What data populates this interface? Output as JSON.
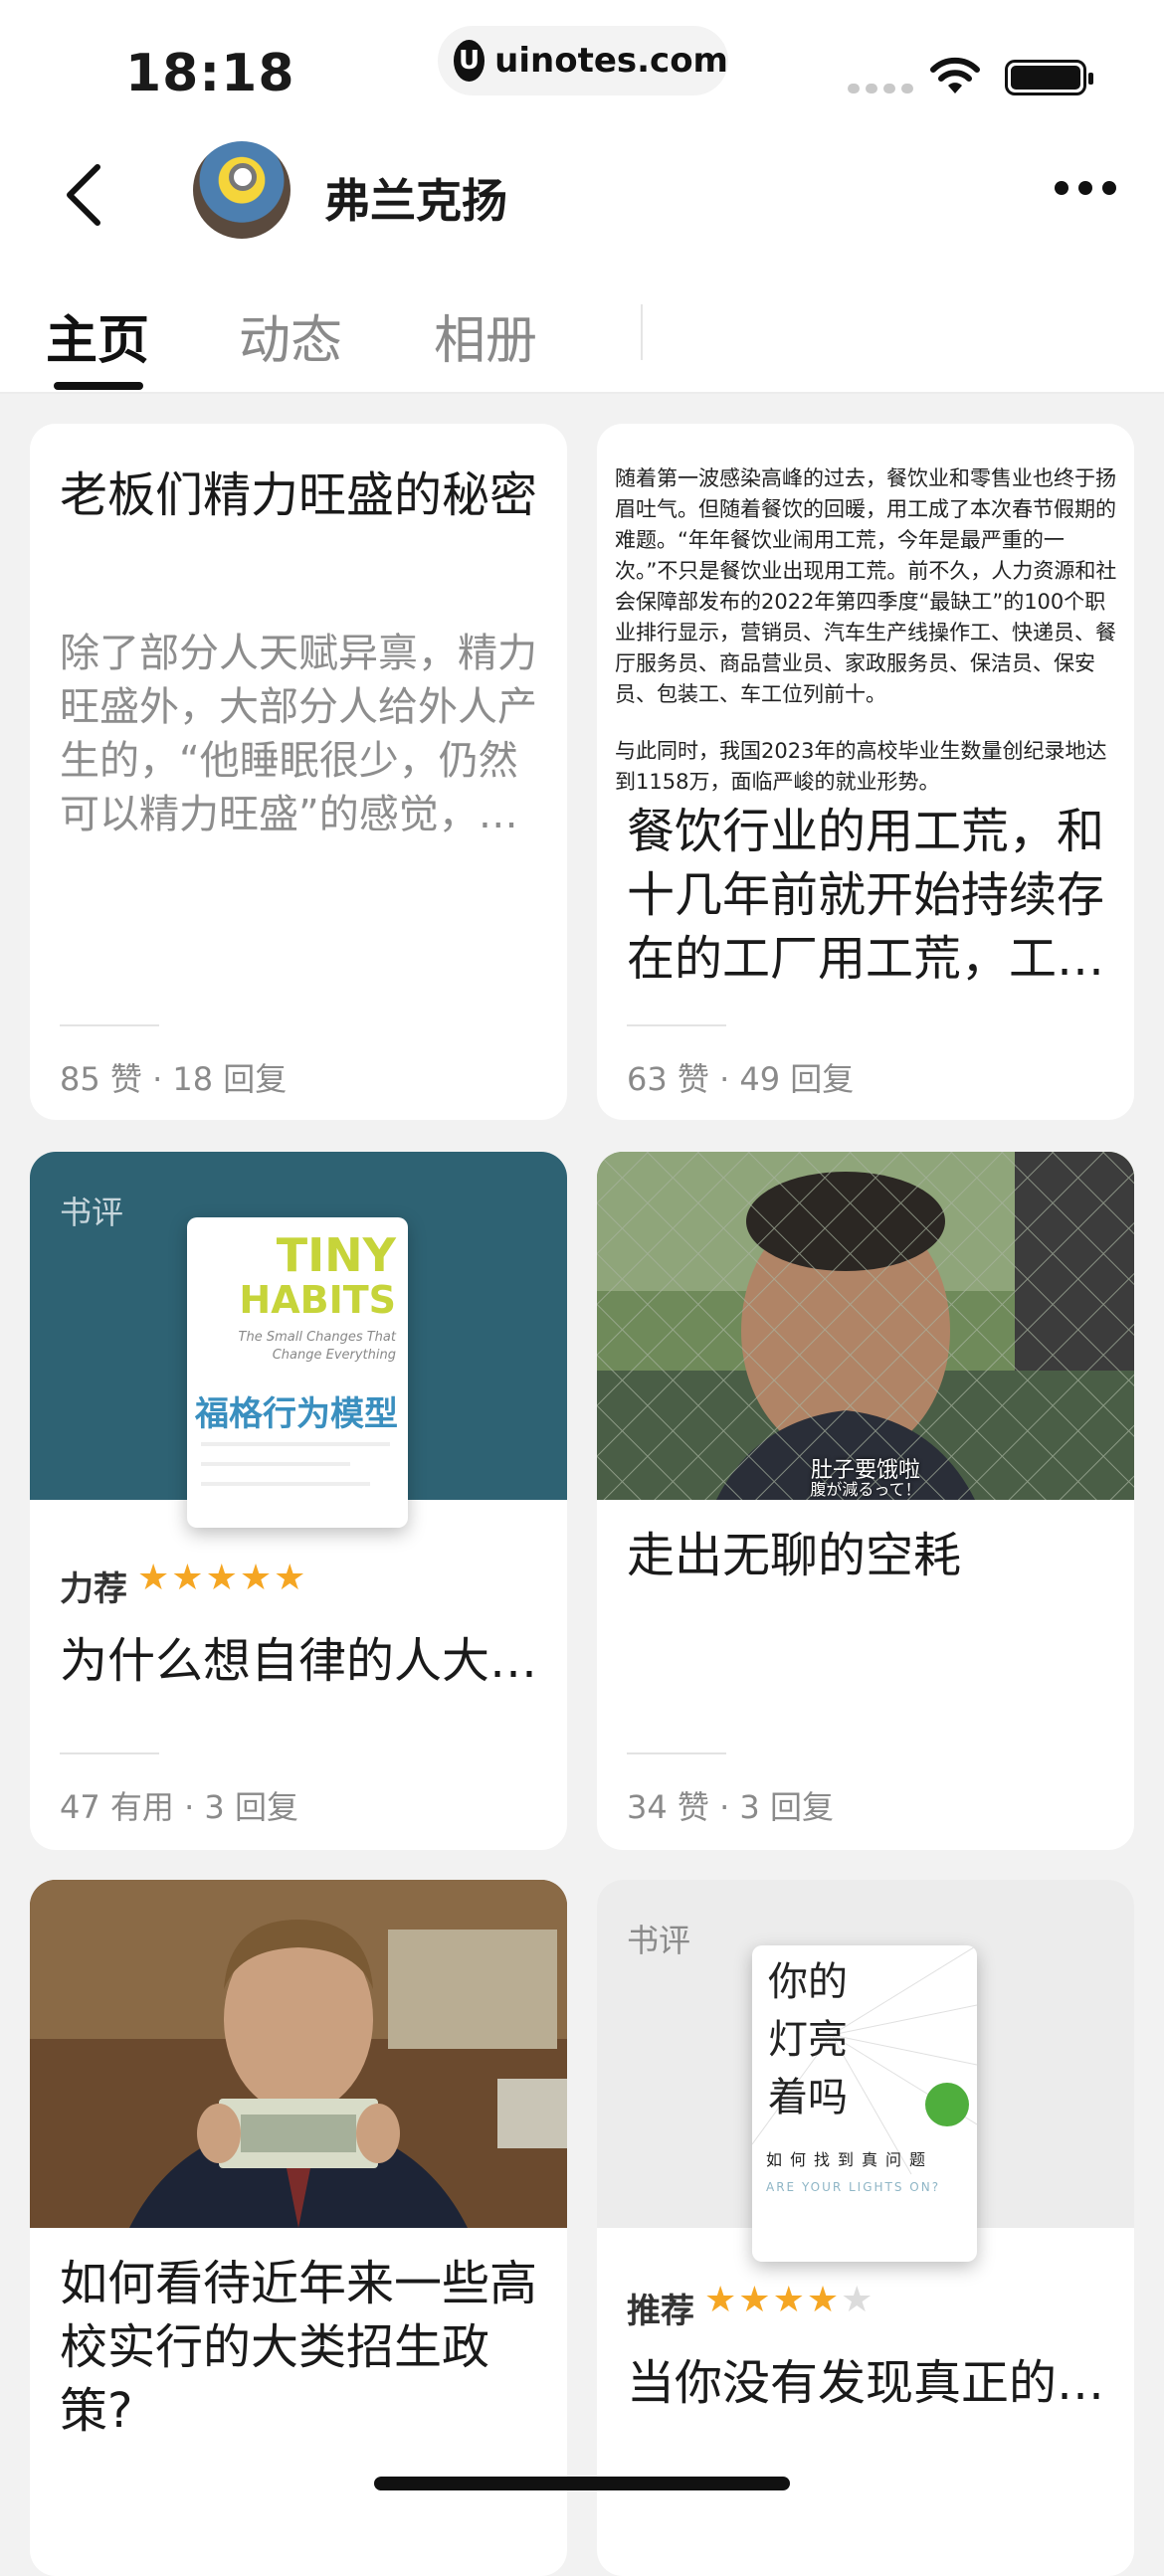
{
  "status": {
    "time": "18:18",
    "url": "uinotes.com"
  },
  "header": {
    "username": "弗兰克扬"
  },
  "tabs": [
    {
      "label": "主页"
    },
    {
      "label": "动态"
    },
    {
      "label": "相册"
    }
  ],
  "cards": [
    {
      "title": "老板们精力旺盛的秘密",
      "excerpt": "除了部分人天赋异禀，精力旺盛外，大部分人给外人产生的，“他睡眠很少，仍然可以精力旺盛”的感觉，…",
      "meta": "85 赞 · 18 回复"
    },
    {
      "doc_paragraphs": [
        "随着第一波感染高峰的过去，餐饮业和零售业也终于扬眉吐气。但随着餐饮的回暖，用工成了本次春节假期的难题。“年年餐饮业闹用工荒，今年是最严重的一次。”不只是餐饮业出现用工荒。前不久，人力资源和社会保障部发布的2022年第四季度“最缺工”的100个职业排行显示，营销员、汽车生产线操作工、快递员、餐厅服务员、商品营业员、家政服务员、保洁员、保安员、包装工、车工位列前十。",
        "与此同时，我国2023年的高校毕业生数量创纪录地达到1158万，面临严峻的就业形势。"
      ],
      "title": "餐饮行业的用工荒，和十几年前就开始持续存在的工厂用工荒，工…",
      "meta": "63 赞 · 49 回复"
    },
    {
      "tag": "书评",
      "book_title_en_1": "TINY",
      "book_title_en_2": "HABITS",
      "book_subtitle_en": "The Small Changes That Change Everything",
      "book_title_cn": "福格行为模型",
      "rating_label": "力荐",
      "rating": 5,
      "title": "为什么想自律的人大…",
      "meta": "47 有用 · 3 回复"
    },
    {
      "subtitle_cn": "肚子要饿啦",
      "subtitle_jp": "腹が減るって！",
      "title": "走出无聊的空耗",
      "meta": "34 赞 · 3 回复"
    },
    {
      "title": "如何看待近年来一些高校实行的大类招生政策?"
    },
    {
      "tag": "书评",
      "book_title_cn": "你的灯亮着吗",
      "book_subtitle_cn": "如何找到真问题",
      "book_title_en": "ARE YOUR LIGHTS ON?",
      "rating_label": "推荐",
      "rating": 4,
      "title": "当你没有发现真正的…"
    }
  ]
}
